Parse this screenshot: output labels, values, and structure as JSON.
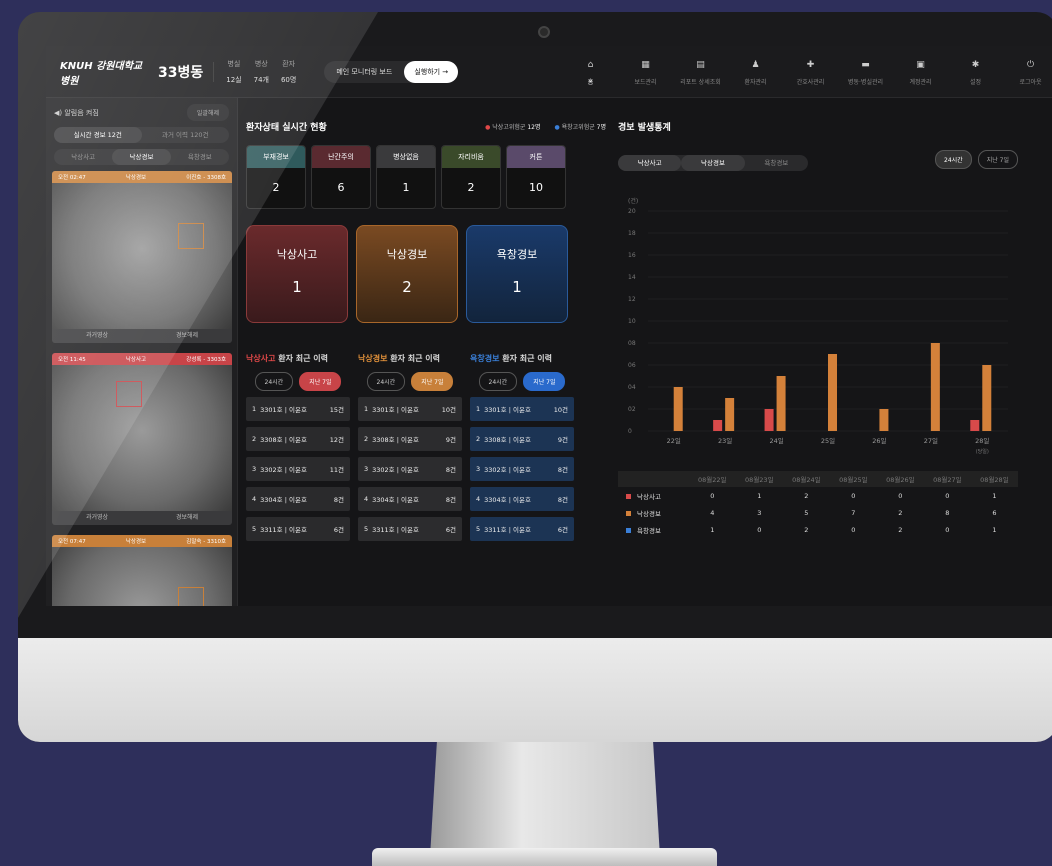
{
  "header": {
    "logo": "KNUH 강원대학교병원",
    "ward": "33병동",
    "stats": [
      {
        "label": "병실",
        "value": "12실"
      },
      {
        "label": "병상",
        "value": "74개"
      },
      {
        "label": "환자",
        "value": "60명"
      }
    ],
    "monitor_label": "메인 모니터링 보드",
    "run_label": "실행하기 →",
    "nav": [
      {
        "icon": "home-icon",
        "glyph": "⌂",
        "label": "홈"
      },
      {
        "icon": "board-icon",
        "glyph": "▦",
        "label": "보드관리"
      },
      {
        "icon": "report-icon",
        "glyph": "▤",
        "label": "리포트 상세조회"
      },
      {
        "icon": "patients-icon",
        "glyph": "♟",
        "label": "환자관리"
      },
      {
        "icon": "nurse-icon",
        "glyph": "✚",
        "label": "간호사관리"
      },
      {
        "icon": "bed-icon",
        "glyph": "▬",
        "label": "병동·병실관리"
      },
      {
        "icon": "account-icon",
        "glyph": "▣",
        "label": "계정관리"
      },
      {
        "icon": "gear-icon",
        "glyph": "✱",
        "label": "설정"
      },
      {
        "icon": "power-icon",
        "glyph": "⏻",
        "label": "로그아웃"
      }
    ]
  },
  "left": {
    "alarm_label": "◀) 알림음 켜짐",
    "bulk_label": "일괄해제",
    "live_label": "실시간 경보",
    "live_count": "12건",
    "past_label": "과거 이력",
    "past_count": "120건",
    "tabs": [
      "낙상사고",
      "낙상경보",
      "욕창경보"
    ],
    "cards": [
      {
        "time": "오전 02:47",
        "type": "낙상경보",
        "who": "이진호 - 3308호",
        "color": "#c8803a"
      },
      {
        "time": "오전 11:45",
        "type": "낙상사고",
        "who": "강성록 - 3303호",
        "color": "#c84448"
      },
      {
        "time": "오전 07:47",
        "type": "낙상경보",
        "who": "김말숙 - 3310호",
        "color": "#c8803a"
      }
    ],
    "past_video": "과거영상",
    "release": "경보해제"
  },
  "status": {
    "title": "환자상태 실시간 현황",
    "legend": [
      {
        "label": "낙상고위험군",
        "count": "12명",
        "color": "#e04848"
      },
      {
        "label": "욕창고위험군",
        "count": "7명",
        "color": "#3a7fd8"
      }
    ],
    "items": [
      {
        "label": "부재경보",
        "value": "2",
        "color": "#2f5a5c"
      },
      {
        "label": "난간주의",
        "value": "6",
        "color": "#5a2a30"
      },
      {
        "label": "병상없음",
        "value": "1",
        "color": "#3a3a3c"
      },
      {
        "label": "자리비움",
        "value": "2",
        "color": "#3a4a2a"
      },
      {
        "label": "커튼",
        "value": "10",
        "color": "#5a4a6a"
      }
    ],
    "big": [
      {
        "label": "낙상사고",
        "value": "1",
        "bg": "linear-gradient(#6a2a2c,#3a1a1c)",
        "border": "#8a3a3a"
      },
      {
        "label": "낙상경보",
        "value": "2",
        "bg": "linear-gradient(#7a4a22,#3a2614)",
        "border": "#a8662a"
      },
      {
        "label": "욕창경보",
        "value": "1",
        "bg": "linear-gradient(#1a3a6a,#12243c)",
        "border": "#2a5a9a"
      }
    ]
  },
  "history": [
    {
      "key": "낙상사고",
      "rest": "환자 최근 이력",
      "keycolor": "#e04848",
      "btn": "지난 7일",
      "btncolor": "#c84448",
      "rowbg": "#2a2a2c",
      "rows": [
        [
          "1",
          "3301호 | 이윤호",
          "15건"
        ],
        [
          "2",
          "3308호 | 이윤호",
          "12건"
        ],
        [
          "3",
          "3302호 | 이윤호",
          "11건"
        ],
        [
          "4",
          "3304호 | 이윤호",
          "8건"
        ],
        [
          "5",
          "3311호 | 이윤호",
          "6건"
        ]
      ]
    },
    {
      "key": "낙상경보",
      "rest": "환자 최근 이력",
      "keycolor": "#e0903a",
      "btn": "지난 7일",
      "btncolor": "#c8803a",
      "rowbg": "#2c2c2e",
      "rows": [
        [
          "1",
          "3301호 | 이윤호",
          "10건"
        ],
        [
          "2",
          "3308호 | 이윤호",
          "9건"
        ],
        [
          "3",
          "3302호 | 이윤호",
          "8건"
        ],
        [
          "4",
          "3304호 | 이윤호",
          "8건"
        ],
        [
          "5",
          "3311호 | 이윤호",
          "6건"
        ]
      ]
    },
    {
      "key": "욕창경보",
      "rest": "환자 최근 이력",
      "keycolor": "#3a7fd8",
      "btn": "지난 7일",
      "btncolor": "#2a6acc",
      "rowbg": "#1c3454",
      "rows": [
        [
          "1",
          "3301호 | 이윤호",
          "10건"
        ],
        [
          "2",
          "3308호 | 이윤호",
          "9건"
        ],
        [
          "3",
          "3302호 | 이윤호",
          "8건"
        ],
        [
          "4",
          "3304호 | 이윤호",
          "8건"
        ],
        [
          "5",
          "3311호 | 이윤호",
          "6건"
        ]
      ]
    }
  ],
  "history_24h": "24시간",
  "chart_title": "경보 발생통계",
  "chart_tabs": [
    "낙상사고",
    "낙상경보",
    "욕창경보"
  ],
  "range": [
    "24시간",
    "지난 7일"
  ],
  "chart_data": {
    "type": "bar",
    "ylabel": "(건)",
    "ylim": [
      0,
      20
    ],
    "yticks": [
      "20",
      "18",
      "16",
      "14",
      "12",
      "10",
      "08",
      "06",
      "04",
      "02",
      "0"
    ],
    "categories": [
      "22일",
      "23일",
      "24일",
      "25일",
      "26일",
      "27일",
      "28일"
    ],
    "last_note": "(당일)",
    "series": [
      {
        "name": "낙상사고",
        "color": "#d84a4a",
        "values": [
          0,
          1,
          2,
          0,
          0,
          0,
          1
        ]
      },
      {
        "name": "낙상경보",
        "color": "#d4813a",
        "values": [
          4,
          3,
          5,
          7,
          2,
          8,
          6
        ]
      }
    ]
  },
  "table": {
    "dates": [
      "08월22일",
      "08월23일",
      "08월24일",
      "08월25일",
      "08월26일",
      "08월27일",
      "08월28일"
    ],
    "rows": [
      {
        "name": "낙상사고",
        "color": "#d84a4a",
        "values": [
          "0",
          "1",
          "2",
          "0",
          "0",
          "0",
          "1"
        ]
      },
      {
        "name": "낙상경보",
        "color": "#d4813a",
        "values": [
          "4",
          "3",
          "5",
          "7",
          "2",
          "8",
          "6"
        ]
      },
      {
        "name": "욕창경보",
        "color": "#3a7fd8",
        "values": [
          "1",
          "0",
          "2",
          "0",
          "2",
          "0",
          "1"
        ]
      }
    ]
  }
}
